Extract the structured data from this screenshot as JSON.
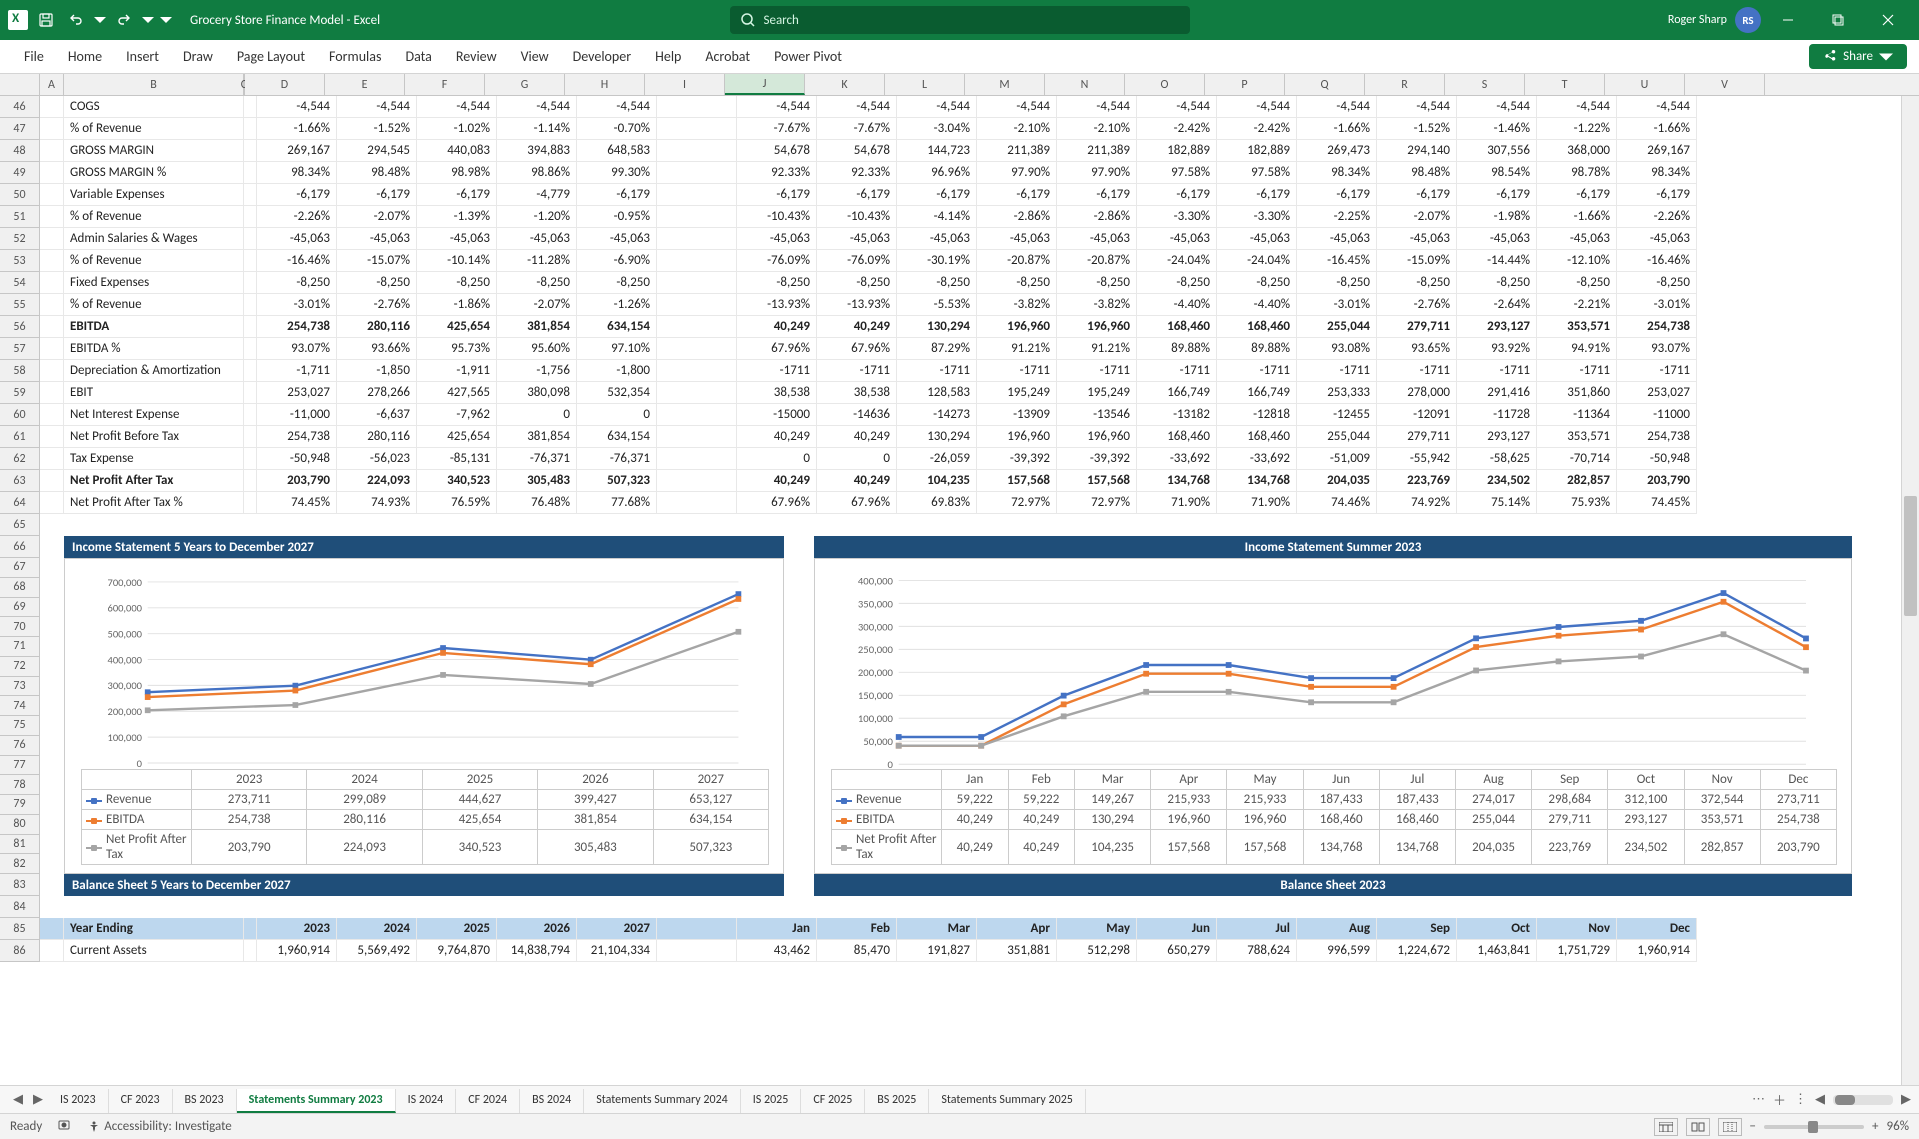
{
  "titlebar": {
    "doc_title": "Grocery Store Finance Model  -  Excel",
    "search_placeholder": "Search",
    "user_name": "Roger Sharp",
    "user_initials": "RS"
  },
  "ribbon": {
    "tabs": [
      "File",
      "Home",
      "Insert",
      "Draw",
      "Page Layout",
      "Formulas",
      "Data",
      "Review",
      "View",
      "Developer",
      "Help",
      "Acrobat",
      "Power Pivot"
    ],
    "share_label": "Share"
  },
  "columns": [
    "",
    "A",
    "B",
    "C",
    "D",
    "E",
    "F",
    "G",
    "H",
    "I",
    "J",
    "K",
    "L",
    "M",
    "N",
    "O",
    "P",
    "Q",
    "R",
    "S",
    "T",
    "U",
    "V"
  ],
  "col_widths": [
    "40",
    "24",
    "180",
    "80",
    "80",
    "80",
    "80",
    "80",
    "80",
    "80",
    "80",
    "80",
    "80",
    "80",
    "80",
    "80",
    "80",
    "80",
    "80",
    "80",
    "80",
    "80",
    "80",
    "80"
  ],
  "rows_start": 46,
  "is_rows": [
    {
      "r": 46,
      "label": "COGS",
      "vals": [
        "-4,544",
        "-4,544",
        "-4,544",
        "-4,544",
        "-4,544",
        "",
        "-4,544",
        "-4,544",
        "-4,544",
        "-4,544",
        "-4,544",
        "-4,544",
        "-4,544",
        "-4,544",
        "-4,544",
        "-4,544",
        "-4,544",
        "-4,544"
      ]
    },
    {
      "r": 47,
      "label": "% of Revenue",
      "vals": [
        "-1.66%",
        "-1.52%",
        "-1.02%",
        "-1.14%",
        "-0.70%",
        "",
        "-7.67%",
        "-7.67%",
        "-3.04%",
        "-2.10%",
        "-2.10%",
        "-2.42%",
        "-2.42%",
        "-1.66%",
        "-1.52%",
        "-1.46%",
        "-1.22%",
        "-1.66%"
      ]
    },
    {
      "r": 48,
      "label": "GROSS MARGIN",
      "vals": [
        "269,167",
        "294,545",
        "440,083",
        "394,883",
        "648,583",
        "",
        "54,678",
        "54,678",
        "144,723",
        "211,389",
        "211,389",
        "182,889",
        "182,889",
        "269,473",
        "294,140",
        "307,556",
        "368,000",
        "269,167"
      ]
    },
    {
      "r": 49,
      "label": "GROSS MARGIN %",
      "vals": [
        "98.34%",
        "98.48%",
        "98.98%",
        "98.86%",
        "99.30%",
        "",
        "92.33%",
        "92.33%",
        "96.96%",
        "97.90%",
        "97.90%",
        "97.58%",
        "97.58%",
        "98.34%",
        "98.48%",
        "98.54%",
        "98.78%",
        "98.34%"
      ]
    },
    {
      "r": 50,
      "label": "Variable Expenses",
      "vals": [
        "-6,179",
        "-6,179",
        "-6,179",
        "-4,779",
        "-6,179",
        "",
        "-6,179",
        "-6,179",
        "-6,179",
        "-6,179",
        "-6,179",
        "-6,179",
        "-6,179",
        "-6,179",
        "-6,179",
        "-6,179",
        "-6,179",
        "-6,179"
      ]
    },
    {
      "r": 51,
      "label": "% of Revenue",
      "vals": [
        "-2.26%",
        "-2.07%",
        "-1.39%",
        "-1.20%",
        "-0.95%",
        "",
        "-10.43%",
        "-10.43%",
        "-4.14%",
        "-2.86%",
        "-2.86%",
        "-3.30%",
        "-3.30%",
        "-2.25%",
        "-2.07%",
        "-1.98%",
        "-1.66%",
        "-2.26%"
      ]
    },
    {
      "r": 52,
      "label": "Admin Salaries & Wages",
      "vals": [
        "-45,063",
        "-45,063",
        "-45,063",
        "-45,063",
        "-45,063",
        "",
        "-45,063",
        "-45,063",
        "-45,063",
        "-45,063",
        "-45,063",
        "-45,063",
        "-45,063",
        "-45,063",
        "-45,063",
        "-45,063",
        "-45,063",
        "-45,063"
      ]
    },
    {
      "r": 53,
      "label": "% of Revenue",
      "vals": [
        "-16.46%",
        "-15.07%",
        "-10.14%",
        "-11.28%",
        "-6.90%",
        "",
        "-76.09%",
        "-76.09%",
        "-30.19%",
        "-20.87%",
        "-20.87%",
        "-24.04%",
        "-24.04%",
        "-16.45%",
        "-15.09%",
        "-14.44%",
        "-12.10%",
        "-16.46%"
      ]
    },
    {
      "r": 54,
      "label": "Fixed Expenses",
      "vals": [
        "-8,250",
        "-8,250",
        "-8,250",
        "-8,250",
        "-8,250",
        "",
        "-8,250",
        "-8,250",
        "-8,250",
        "-8,250",
        "-8,250",
        "-8,250",
        "-8,250",
        "-8,250",
        "-8,250",
        "-8,250",
        "-8,250",
        "-8,250"
      ]
    },
    {
      "r": 55,
      "label": "% of Revenue",
      "vals": [
        "-3.01%",
        "-2.76%",
        "-1.86%",
        "-2.07%",
        "-1.26%",
        "",
        "-13.93%",
        "-13.93%",
        "-5.53%",
        "-3.82%",
        "-3.82%",
        "-4.40%",
        "-4.40%",
        "-3.01%",
        "-2.76%",
        "-2.64%",
        "-2.21%",
        "-3.01%"
      ]
    },
    {
      "r": 56,
      "label": "EBITDA",
      "bold": true,
      "vals": [
        "254,738",
        "280,116",
        "425,654",
        "381,854",
        "634,154",
        "",
        "40,249",
        "40,249",
        "130,294",
        "196,960",
        "196,960",
        "168,460",
        "168,460",
        "255,044",
        "279,711",
        "293,127",
        "353,571",
        "254,738"
      ]
    },
    {
      "r": 57,
      "label": "EBITDA %",
      "vals": [
        "93.07%",
        "93.66%",
        "95.73%",
        "95.60%",
        "97.10%",
        "",
        "67.96%",
        "67.96%",
        "87.29%",
        "91.21%",
        "91.21%",
        "89.88%",
        "89.88%",
        "93.08%",
        "93.65%",
        "93.92%",
        "94.91%",
        "93.07%"
      ]
    },
    {
      "r": 58,
      "label": "Depreciation & Amortization",
      "vals": [
        "-1,711",
        "-1,850",
        "-1,911",
        "-1,756",
        "-1,800",
        "",
        "-1711",
        "-1711",
        "-1711",
        "-1711",
        "-1711",
        "-1711",
        "-1711",
        "-1711",
        "-1711",
        "-1711",
        "-1711",
        "-1711"
      ]
    },
    {
      "r": 59,
      "label": "EBIT",
      "vals": [
        "253,027",
        "278,266",
        "427,565",
        "380,098",
        "532,354",
        "",
        "38,538",
        "38,538",
        "128,583",
        "195,249",
        "195,249",
        "166,749",
        "166,749",
        "253,333",
        "278,000",
        "291,416",
        "351,860",
        "253,027"
      ]
    },
    {
      "r": 60,
      "label": "Net Interest Expense",
      "vals": [
        "-11,000",
        "-6,637",
        "-7,962",
        "0",
        "0",
        "",
        "-15000",
        "-14636",
        "-14273",
        "-13909",
        "-13546",
        "-13182",
        "-12818",
        "-12455",
        "-12091",
        "-11728",
        "-11364",
        "-11000"
      ]
    },
    {
      "r": 61,
      "label": "Net Profit Before Tax",
      "vals": [
        "254,738",
        "280,116",
        "425,654",
        "381,854",
        "634,154",
        "",
        "40,249",
        "40,249",
        "130,294",
        "196,960",
        "196,960",
        "168,460",
        "168,460",
        "255,044",
        "279,711",
        "293,127",
        "353,571",
        "254,738"
      ]
    },
    {
      "r": 62,
      "label": "Tax Expense",
      "vals": [
        "-50,948",
        "-56,023",
        "-85,131",
        "-76,371",
        "-76,371",
        "",
        "0",
        "0",
        "-26,059",
        "-39,392",
        "-39,392",
        "-33,692",
        "-33,692",
        "-51,009",
        "-55,942",
        "-58,625",
        "-70,714",
        "-50,948"
      ]
    },
    {
      "r": 63,
      "label": "Net Profit After Tax",
      "bold": true,
      "vals": [
        "203,790",
        "224,093",
        "340,523",
        "305,483",
        "507,323",
        "",
        "40,249",
        "40,249",
        "104,235",
        "157,568",
        "157,568",
        "134,768",
        "134,768",
        "204,035",
        "223,769",
        "234,502",
        "282,857",
        "203,790"
      ]
    },
    {
      "r": 64,
      "label": "Net Profit After Tax %",
      "vals": [
        "74.45%",
        "74.93%",
        "76.59%",
        "76.48%",
        "77.68%",
        "",
        "67.96%",
        "67.96%",
        "69.83%",
        "72.97%",
        "72.97%",
        "71.90%",
        "71.90%",
        "74.46%",
        "74.92%",
        "75.14%",
        "75.93%",
        "74.45%"
      ]
    }
  ],
  "charts": {
    "left": {
      "title": "Income Statement 5 Years to December 2027",
      "x": [
        "2023",
        "2024",
        "2025",
        "2026",
        "2027"
      ],
      "series": [
        {
          "name": "Revenue",
          "color": "#4472c4",
          "values": [
            273711,
            299089,
            444627,
            399427,
            653127
          ]
        },
        {
          "name": "EBITDA",
          "color": "#ed7d31",
          "values": [
            254738,
            280116,
            425654,
            381854,
            634154
          ]
        },
        {
          "name": "Net Profit After Tax",
          "color": "#a5a5a5",
          "values": [
            203790,
            224093,
            340523,
            305483,
            507323
          ]
        }
      ],
      "ymax": 700000,
      "yticks": [
        "0",
        "100,000",
        "200,000",
        "300,000",
        "400,000",
        "500,000",
        "600,000",
        "700,000"
      ]
    },
    "right": {
      "title": "Income Statement Summer 2023",
      "x": [
        "Jan",
        "Feb",
        "Mar",
        "Apr",
        "May",
        "Jun",
        "Jul",
        "Aug",
        "Sep",
        "Oct",
        "Nov",
        "Dec"
      ],
      "series": [
        {
          "name": "Revenue",
          "color": "#4472c4",
          "values": [
            59222,
            59222,
            149267,
            215933,
            215933,
            187433,
            187433,
            274017,
            298684,
            312100,
            372544,
            273711
          ]
        },
        {
          "name": "EBITDA",
          "color": "#ed7d31",
          "values": [
            40249,
            40249,
            130294,
            196960,
            196960,
            168460,
            168460,
            255044,
            279711,
            293127,
            353571,
            254738
          ]
        },
        {
          "name": "Net Profit After Tax",
          "color": "#a5a5a5",
          "values": [
            40249,
            40249,
            104235,
            157568,
            157568,
            134768,
            134768,
            204035,
            223769,
            234502,
            282857,
            203790
          ]
        }
      ],
      "ymax": 400000,
      "yticks": [
        "0",
        "50,000",
        "100,000",
        "150,000",
        "200,000",
        "250,000",
        "300,000",
        "350,000",
        "400,000"
      ]
    }
  },
  "chart_data": [
    {
      "type": "line",
      "title": "Income Statement 5 Years to December 2027",
      "categories": [
        "2023",
        "2024",
        "2025",
        "2026",
        "2027"
      ],
      "series": [
        {
          "name": "Revenue",
          "values": [
            273711,
            299089,
            444627,
            399427,
            653127
          ]
        },
        {
          "name": "EBITDA",
          "values": [
            254738,
            280116,
            425654,
            381854,
            634154
          ]
        },
        {
          "name": "Net Profit After Tax",
          "values": [
            203790,
            224093,
            340523,
            305483,
            507323
          ]
        }
      ],
      "ylim": [
        0,
        700000
      ]
    },
    {
      "type": "line",
      "title": "Income Statement Summer 2023",
      "categories": [
        "Jan",
        "Feb",
        "Mar",
        "Apr",
        "May",
        "Jun",
        "Jul",
        "Aug",
        "Sep",
        "Oct",
        "Nov",
        "Dec"
      ],
      "series": [
        {
          "name": "Revenue",
          "values": [
            59222,
            59222,
            149267,
            215933,
            215933,
            187433,
            187433,
            274017,
            298684,
            312100,
            372544,
            273711
          ]
        },
        {
          "name": "EBITDA",
          "values": [
            40249,
            40249,
            130294,
            196960,
            196960,
            168460,
            168460,
            255044,
            279711,
            293127,
            353571,
            254738
          ]
        },
        {
          "name": "Net Profit After Tax",
          "values": [
            40249,
            40249,
            104235,
            157568,
            157568,
            134768,
            134768,
            204035,
            223769,
            234502,
            282857,
            203790
          ]
        }
      ],
      "ylim": [
        0,
        400000
      ]
    }
  ],
  "bs": {
    "left_title": "Balance Sheet 5 Years to December 2027",
    "right_title": "Balance Sheet 2023",
    "header_label": "Year Ending",
    "years": [
      "2023",
      "2024",
      "2025",
      "2026",
      "2027"
    ],
    "months": [
      "Jan",
      "Feb",
      "Mar",
      "Apr",
      "May",
      "Jun",
      "Jul",
      "Aug",
      "Sep",
      "Oct",
      "Nov",
      "Dec"
    ],
    "ca_label": "Current Assets",
    "ca_years": [
      "1,960,914",
      "5,569,492",
      "9,764,870",
      "14,838,794",
      "21,104,334"
    ],
    "ca_months": [
      "43,462",
      "85,470",
      "191,827",
      "351,881",
      "512,298",
      "650,279",
      "788,624",
      "996,599",
      "1,224,672",
      "1,463,841",
      "1,751,729",
      "1,960,914"
    ]
  },
  "tabs": [
    "IS 2023",
    "CF 2023",
    "BS 2023",
    "Statements Summary 2023",
    "IS 2024",
    "CF 2024",
    "BS 2024",
    "Statements Summary 2024",
    "IS 2025",
    "CF 2025",
    "BS 2025",
    "Statements Summary 2025"
  ],
  "active_tab": 3,
  "statusbar": {
    "ready": "Ready",
    "accessibility": "Accessibility: Investigate",
    "zoom": "96%"
  }
}
